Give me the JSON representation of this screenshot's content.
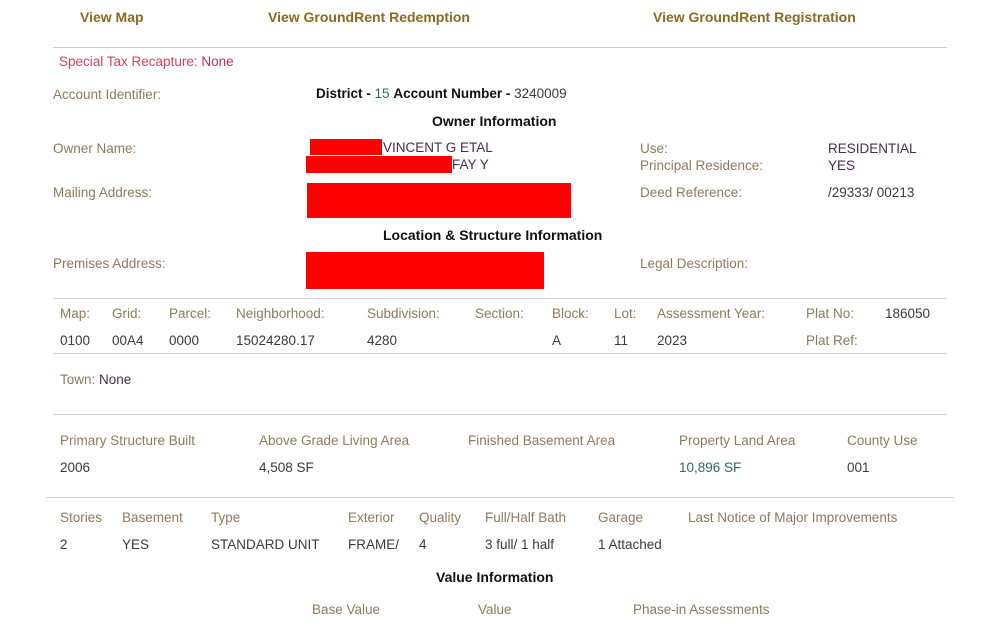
{
  "nav": {
    "view_map": "View Map",
    "view_groundrent_redemption": "View GroundRent Redemption",
    "view_groundrent_registration": "View GroundRent Registration"
  },
  "special_tax": {
    "label": "Special Tax Recapture:",
    "value": "None"
  },
  "account": {
    "label": "Account Identifier:",
    "district_label": "District -",
    "district_value": "15",
    "account_number_label": "Account Number -",
    "account_number_value": "3240009"
  },
  "owner_section": {
    "title": "Owner Information",
    "owner_name_label": "Owner Name:",
    "owner_name_line1": "VINCENT G ETAL",
    "owner_name_line2": "FAY Y",
    "mailing_address_label": "Mailing Address:",
    "use_label": "Use:",
    "use_value": "RESIDENTIAL",
    "principal_residence_label": "Principal Residence:",
    "principal_residence_value": "YES",
    "deed_reference_label": "Deed Reference:",
    "deed_reference_value": "/29333/ 00213"
  },
  "location_section": {
    "title": "Location & Structure Information",
    "premises_address_label": "Premises Address:",
    "legal_description_label": "Legal Description:"
  },
  "parcel_table": {
    "headers": [
      "Map:",
      "Grid:",
      "Parcel:",
      "Neighborhood:",
      "Subdivision:",
      "Section:",
      "Block:",
      "Lot:",
      "Assessment Year:",
      "Plat No:"
    ],
    "values": [
      "0100",
      "00A4",
      "0000",
      "15024280.17",
      "4280",
      "",
      "A",
      "11",
      "2023",
      "Plat Ref:"
    ],
    "plat_no_value": "186050"
  },
  "town": {
    "label": "Town:",
    "value": "None"
  },
  "structure_table": {
    "headers": [
      "Primary Structure Built",
      "Above Grade Living Area",
      "Finished Basement Area",
      "Property Land Area",
      "County Use"
    ],
    "values": [
      "2006",
      "4,508 SF",
      "",
      "10,896 SF",
      "001"
    ]
  },
  "details_table": {
    "headers": [
      "Stories",
      "Basement",
      "Type",
      "Exterior",
      "Quality",
      "Full/Half Bath",
      "Garage",
      "Last Notice of Major Improvements"
    ],
    "values": [
      "2",
      "YES",
      "STANDARD UNIT",
      "FRAME/",
      "4",
      "3 full/ 1 half",
      "1 Attached",
      ""
    ]
  },
  "value_section": {
    "title": "Value Information",
    "headers": [
      "Base Value",
      "Value",
      "Phase-in Assessments"
    ]
  }
}
